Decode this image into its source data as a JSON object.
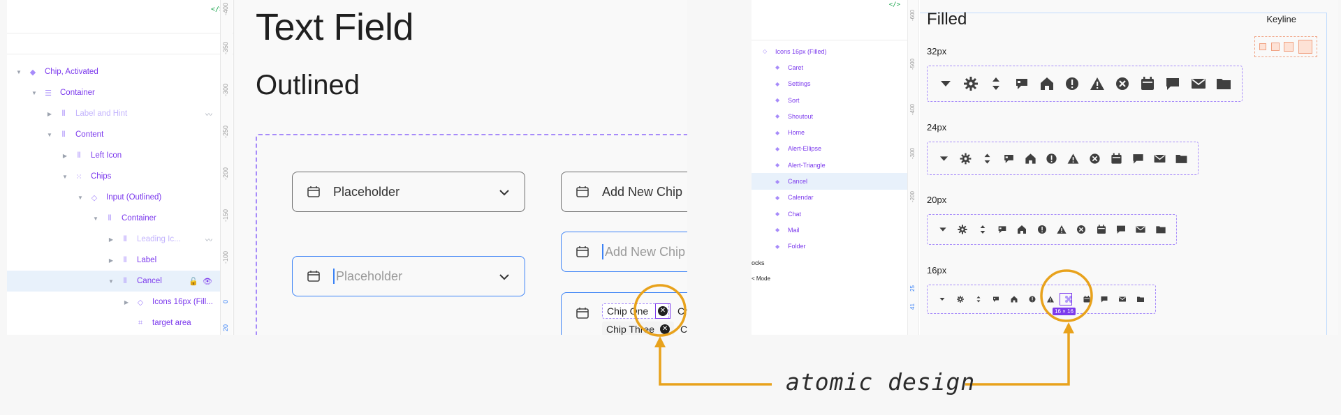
{
  "left_panel": {
    "code_icon": "</>",
    "ruler": [
      "-400",
      "-350",
      "-300",
      "-250",
      "-200",
      "-150",
      "-100",
      "0",
      "20"
    ],
    "layers": [
      {
        "label": "Chip, Activated",
        "icon": "diamond-icon",
        "depth": 0,
        "expanded": true
      },
      {
        "label": "Container",
        "icon": "lines-icon",
        "depth": 1,
        "expanded": true
      },
      {
        "label": "Label and Hint",
        "icon": "columns-icon",
        "depth": 2,
        "expanded": false,
        "muted": true
      },
      {
        "label": "Content",
        "icon": "columns-icon",
        "depth": 2,
        "expanded": true
      },
      {
        "label": "Left Icon",
        "icon": "columns-icon",
        "depth": 3,
        "expanded": false
      },
      {
        "label": "Chips",
        "icon": "grid-icon",
        "depth": 3,
        "expanded": true
      },
      {
        "label": "Input (Outlined)",
        "icon": "diamond-outline-icon",
        "depth": 4,
        "expanded": true
      },
      {
        "label": "Container",
        "icon": "columns-icon",
        "depth": 5,
        "expanded": true
      },
      {
        "label": "Leading Ic...",
        "icon": "columns-icon",
        "depth": 6,
        "expanded": false,
        "muted": true
      },
      {
        "label": "Label",
        "icon": "columns-icon",
        "depth": 6,
        "expanded": false
      },
      {
        "label": "Cancel",
        "icon": "columns-icon",
        "depth": 6,
        "expanded": true,
        "selected": true
      },
      {
        "label": "Icons 16px (Fill...",
        "icon": "diamond-outline-icon",
        "depth": 7,
        "expanded": false
      },
      {
        "label": "target area",
        "icon": "target-icon",
        "depth": 7,
        "expanded": false
      }
    ]
  },
  "middle": {
    "title": "Text Field",
    "subtitle": "Outlined",
    "fields": {
      "placeholder_1": "Placeholder",
      "placeholder_2": "Placeholder",
      "add_chip_1": "Add New Chip",
      "add_chip_2": "Add New Chip"
    },
    "chips": [
      "Chip One",
      "Ch",
      "Chip Three",
      "C"
    ]
  },
  "right_panel": {
    "code_icon": "</>",
    "tree_header": "Icons 16px (Filled)",
    "tree_items": [
      "Caret",
      "Settings",
      "Sort",
      "Shoutout",
      "Home",
      "Alert-Ellipse",
      "Alert-Triangle",
      "Cancel",
      "Calendar",
      "Chat",
      "Mail",
      "Folder"
    ],
    "selected_item": "Cancel",
    "other_rows": [
      "ocks",
      "< Mode"
    ],
    "ruler": [
      "-600",
      "-500",
      "-400",
      "-300",
      "-200",
      "25",
      "41"
    ],
    "title": "Filled",
    "keyline": "Keyline",
    "sizes": [
      "32px",
      "24px",
      "20px",
      "16px"
    ],
    "size_badge": "16 × 16",
    "icons": [
      "caret-icon",
      "settings-icon",
      "sort-icon",
      "shoutout-icon",
      "home-icon",
      "alert-ellipse-icon",
      "alert-triangle-icon",
      "cancel-icon",
      "calendar-icon",
      "chat-icon",
      "mail-icon",
      "folder-icon"
    ]
  },
  "annotation": {
    "label": "atomic design"
  },
  "colors": {
    "accent_purple": "#7c3aed",
    "accent_blue": "#3b82f6",
    "highlight_orange": "#e8a21c",
    "keyline_orange": "#f0a080"
  }
}
